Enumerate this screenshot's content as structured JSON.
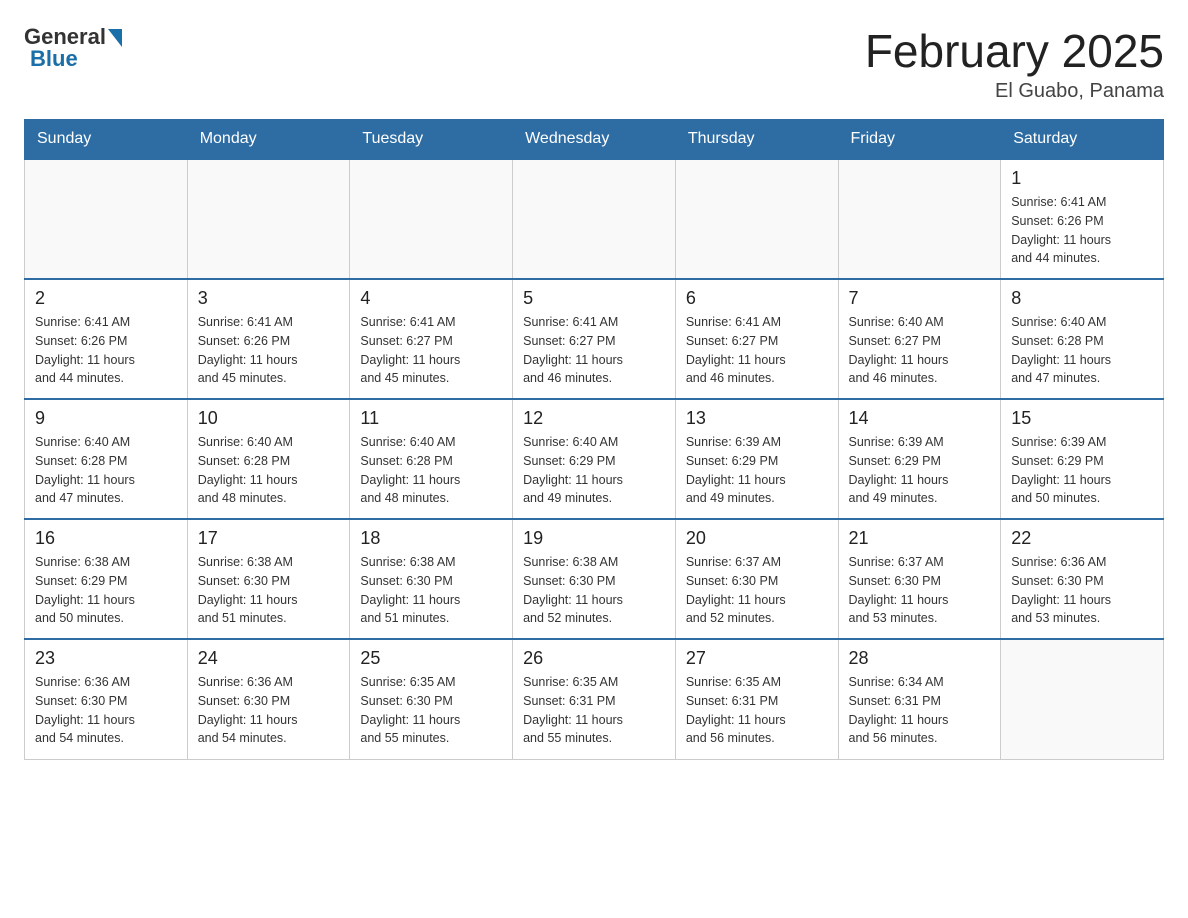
{
  "header": {
    "logo": {
      "general": "General",
      "blue": "Blue"
    },
    "title": "February 2025",
    "location": "El Guabo, Panama"
  },
  "weekdays": [
    "Sunday",
    "Monday",
    "Tuesday",
    "Wednesday",
    "Thursday",
    "Friday",
    "Saturday"
  ],
  "weeks": [
    [
      {
        "day": "",
        "info": ""
      },
      {
        "day": "",
        "info": ""
      },
      {
        "day": "",
        "info": ""
      },
      {
        "day": "",
        "info": ""
      },
      {
        "day": "",
        "info": ""
      },
      {
        "day": "",
        "info": ""
      },
      {
        "day": "1",
        "info": "Sunrise: 6:41 AM\nSunset: 6:26 PM\nDaylight: 11 hours\nand 44 minutes."
      }
    ],
    [
      {
        "day": "2",
        "info": "Sunrise: 6:41 AM\nSunset: 6:26 PM\nDaylight: 11 hours\nand 44 minutes."
      },
      {
        "day": "3",
        "info": "Sunrise: 6:41 AM\nSunset: 6:26 PM\nDaylight: 11 hours\nand 45 minutes."
      },
      {
        "day": "4",
        "info": "Sunrise: 6:41 AM\nSunset: 6:27 PM\nDaylight: 11 hours\nand 45 minutes."
      },
      {
        "day": "5",
        "info": "Sunrise: 6:41 AM\nSunset: 6:27 PM\nDaylight: 11 hours\nand 46 minutes."
      },
      {
        "day": "6",
        "info": "Sunrise: 6:41 AM\nSunset: 6:27 PM\nDaylight: 11 hours\nand 46 minutes."
      },
      {
        "day": "7",
        "info": "Sunrise: 6:40 AM\nSunset: 6:27 PM\nDaylight: 11 hours\nand 46 minutes."
      },
      {
        "day": "8",
        "info": "Sunrise: 6:40 AM\nSunset: 6:28 PM\nDaylight: 11 hours\nand 47 minutes."
      }
    ],
    [
      {
        "day": "9",
        "info": "Sunrise: 6:40 AM\nSunset: 6:28 PM\nDaylight: 11 hours\nand 47 minutes."
      },
      {
        "day": "10",
        "info": "Sunrise: 6:40 AM\nSunset: 6:28 PM\nDaylight: 11 hours\nand 48 minutes."
      },
      {
        "day": "11",
        "info": "Sunrise: 6:40 AM\nSunset: 6:28 PM\nDaylight: 11 hours\nand 48 minutes."
      },
      {
        "day": "12",
        "info": "Sunrise: 6:40 AM\nSunset: 6:29 PM\nDaylight: 11 hours\nand 49 minutes."
      },
      {
        "day": "13",
        "info": "Sunrise: 6:39 AM\nSunset: 6:29 PM\nDaylight: 11 hours\nand 49 minutes."
      },
      {
        "day": "14",
        "info": "Sunrise: 6:39 AM\nSunset: 6:29 PM\nDaylight: 11 hours\nand 49 minutes."
      },
      {
        "day": "15",
        "info": "Sunrise: 6:39 AM\nSunset: 6:29 PM\nDaylight: 11 hours\nand 50 minutes."
      }
    ],
    [
      {
        "day": "16",
        "info": "Sunrise: 6:38 AM\nSunset: 6:29 PM\nDaylight: 11 hours\nand 50 minutes."
      },
      {
        "day": "17",
        "info": "Sunrise: 6:38 AM\nSunset: 6:30 PM\nDaylight: 11 hours\nand 51 minutes."
      },
      {
        "day": "18",
        "info": "Sunrise: 6:38 AM\nSunset: 6:30 PM\nDaylight: 11 hours\nand 51 minutes."
      },
      {
        "day": "19",
        "info": "Sunrise: 6:38 AM\nSunset: 6:30 PM\nDaylight: 11 hours\nand 52 minutes."
      },
      {
        "day": "20",
        "info": "Sunrise: 6:37 AM\nSunset: 6:30 PM\nDaylight: 11 hours\nand 52 minutes."
      },
      {
        "day": "21",
        "info": "Sunrise: 6:37 AM\nSunset: 6:30 PM\nDaylight: 11 hours\nand 53 minutes."
      },
      {
        "day": "22",
        "info": "Sunrise: 6:36 AM\nSunset: 6:30 PM\nDaylight: 11 hours\nand 53 minutes."
      }
    ],
    [
      {
        "day": "23",
        "info": "Sunrise: 6:36 AM\nSunset: 6:30 PM\nDaylight: 11 hours\nand 54 minutes."
      },
      {
        "day": "24",
        "info": "Sunrise: 6:36 AM\nSunset: 6:30 PM\nDaylight: 11 hours\nand 54 minutes."
      },
      {
        "day": "25",
        "info": "Sunrise: 6:35 AM\nSunset: 6:30 PM\nDaylight: 11 hours\nand 55 minutes."
      },
      {
        "day": "26",
        "info": "Sunrise: 6:35 AM\nSunset: 6:31 PM\nDaylight: 11 hours\nand 55 minutes."
      },
      {
        "day": "27",
        "info": "Sunrise: 6:35 AM\nSunset: 6:31 PM\nDaylight: 11 hours\nand 56 minutes."
      },
      {
        "day": "28",
        "info": "Sunrise: 6:34 AM\nSunset: 6:31 PM\nDaylight: 11 hours\nand 56 minutes."
      },
      {
        "day": "",
        "info": ""
      }
    ]
  ]
}
